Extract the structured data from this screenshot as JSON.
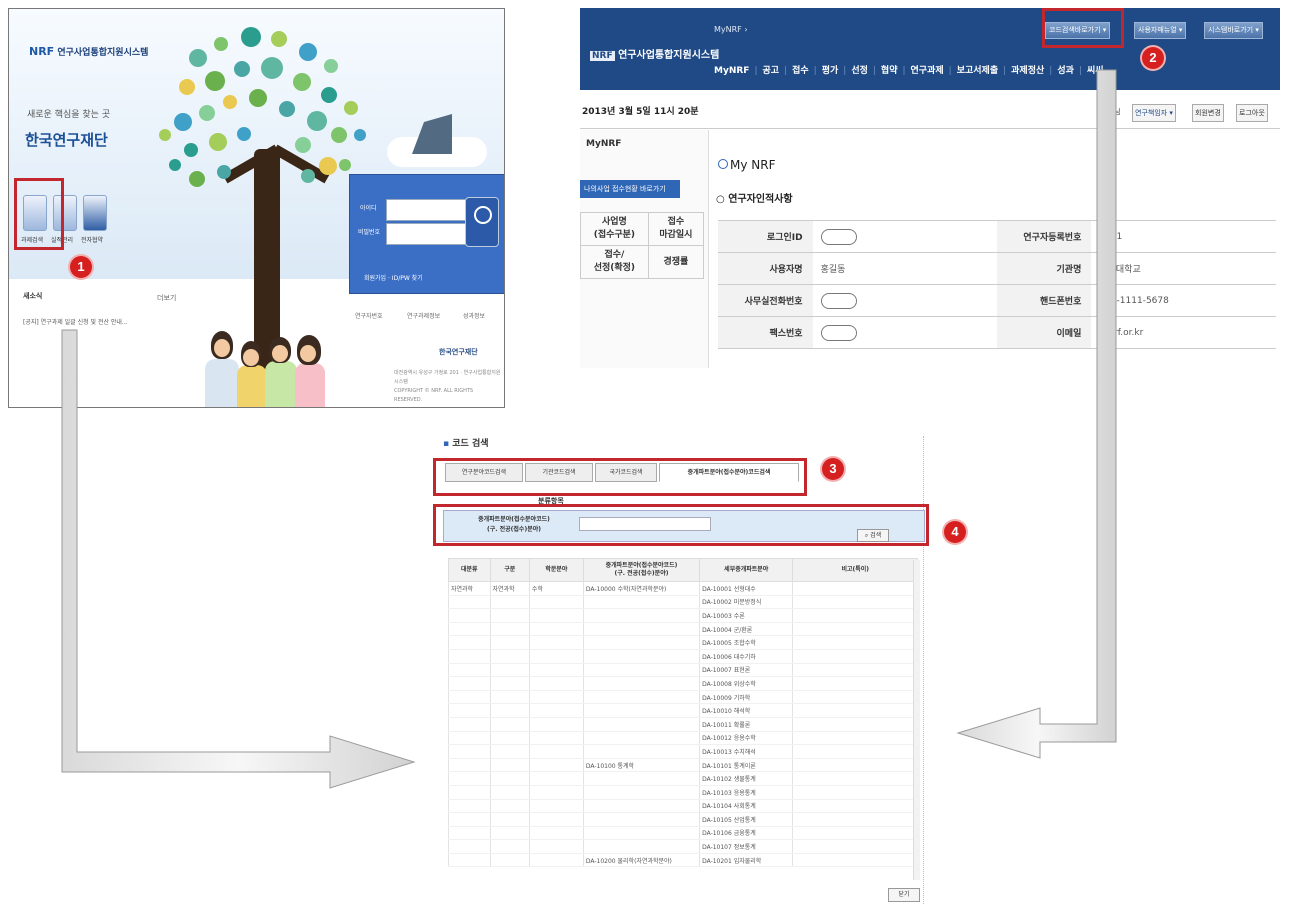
{
  "portal": {
    "logo_mark": "NRF",
    "logo_text": "연구사업통합지원시스템",
    "slogan": "새로운 핵심을 찾는 곳",
    "brand": "한국연구재단",
    "quick_icons": [
      "과제검색",
      "실적관리",
      "전자협약"
    ],
    "login": {
      "id_label": "아이디",
      "pw_label": "비밀번호",
      "link_text": "회원가입 · ID/PW 찾기"
    },
    "service_tabs": [
      "연구자번호",
      "연구과제정보",
      "성과정보"
    ],
    "notice_title": "새소식",
    "notice_more": "더보기",
    "notice_item": "[공지] 연구과제 일괄 신청 및 전산 안내...",
    "footer_logo": "한국연구재단",
    "footer_address": "대전광역시 유성구 가정로 201 · 연구사업통합지원시스템",
    "footer_copyright": "COPYRIGHT © NRF. ALL RIGHTS RESERVED."
  },
  "mynrf": {
    "logo_mark": "NRF",
    "logo_text": "연구사업통합지원시스템",
    "breadcrumb": "MyNRF",
    "top_buttons": [
      "코드검색바로가기",
      "사용자매뉴얼",
      "시스템바로가기"
    ],
    "menu": [
      "MyNRF",
      "공고",
      "접수",
      "평가",
      "선정",
      "협약",
      "연구과제",
      "보고서제출",
      "과제정산",
      "성과",
      "씨씨"
    ],
    "date": "2013년 3월 5일 11시 20분",
    "user_buttons": [
      "님",
      "연구책임자",
      "회원변경",
      "로그아웃"
    ],
    "side_title": "MyNRF",
    "side_highlight": "나의사업 접수현황 바로가기",
    "side_table": [
      [
        "사업명\n(접수구분)",
        "접수\n마감일시"
      ],
      [
        "접수/\n선정(확정)",
        "경쟁률"
      ]
    ],
    "page_title": "My NRF",
    "section_title": "연구자인적사항",
    "info_rows": [
      {
        "l1": "로그인ID",
        "v1": "",
        "l2": "연구자등록번호",
        "v2": "1111"
      },
      {
        "l1": "사용자명",
        "v1": "홍길동",
        "l2": "기관명",
        "v2": "한국대학교"
      },
      {
        "l1": "사무실전화번호",
        "v1": "",
        "l2": "핸드폰번호",
        "v2": "010-1111-5678"
      },
      {
        "l1": "팩스번호",
        "v1": "",
        "l2": "이메일",
        "v2": "@nrf.or.kr"
      }
    ]
  },
  "search": {
    "title": "코드 검색",
    "tabs": [
      "연구분야코드검색",
      "기관코드검색",
      "국가코드검색",
      "중개파트분야(접수분야)코드검색"
    ],
    "section_label": "분류항목",
    "field_label_line1": "중개파트분야(접수분야코드)",
    "field_label_line2": "(구. 전공(접수)분야)",
    "search_button": "검색",
    "columns": [
      "대분류",
      "구분",
      "학문분야",
      "중개파트분야(접수분야코드)\n(구. 전공(접수)분야)",
      "세부중개파트분야",
      "비고(특이)"
    ],
    "rows": [
      [
        "자연과학",
        "자연과학",
        "수학",
        "DA-10000 수학(자연과학분야)",
        "DA-10001 선형대수",
        ""
      ],
      [
        "",
        "",
        "",
        "",
        "DA-10002 미분방정식",
        ""
      ],
      [
        "",
        "",
        "",
        "",
        "DA-10003 수론",
        ""
      ],
      [
        "",
        "",
        "",
        "",
        "DA-10004 군/환론",
        ""
      ],
      [
        "",
        "",
        "",
        "",
        "DA-10005 조합수학",
        ""
      ],
      [
        "",
        "",
        "",
        "",
        "DA-10006 대수기하",
        ""
      ],
      [
        "",
        "",
        "",
        "",
        "DA-10007 표현론",
        ""
      ],
      [
        "",
        "",
        "",
        "",
        "DA-10008 위상수학",
        ""
      ],
      [
        "",
        "",
        "",
        "",
        "DA-10009 기하학",
        ""
      ],
      [
        "",
        "",
        "",
        "",
        "DA-10010 해석학",
        ""
      ],
      [
        "",
        "",
        "",
        "",
        "DA-10011 확률론",
        ""
      ],
      [
        "",
        "",
        "",
        "",
        "DA-10012 응용수학",
        ""
      ],
      [
        "",
        "",
        "",
        "",
        "DA-10013 수치해석",
        ""
      ],
      [
        "",
        "",
        "",
        "DA-10100 통계학",
        "DA-10101 통계이론",
        ""
      ],
      [
        "",
        "",
        "",
        "",
        "DA-10102 생물통계",
        ""
      ],
      [
        "",
        "",
        "",
        "",
        "DA-10103 응용통계",
        ""
      ],
      [
        "",
        "",
        "",
        "",
        "DA-10104 사회통계",
        ""
      ],
      [
        "",
        "",
        "",
        "",
        "DA-10105 산업통계",
        ""
      ],
      [
        "",
        "",
        "",
        "",
        "DA-10106 금융통계",
        ""
      ],
      [
        "",
        "",
        "",
        "",
        "DA-10107 정보통계",
        ""
      ],
      [
        "",
        "",
        "",
        "DA-10200 물리학(자연과학분야)",
        "DA-10201 입자물리학",
        ""
      ]
    ],
    "close_button": "닫기"
  },
  "markers": [
    "1",
    "2",
    "3",
    "4"
  ],
  "colors": {
    "annotation_red": "#c1272d",
    "marker_red": "#d6201f",
    "nav_blue": "#1f4a86",
    "login_blue": "#3b6fc6"
  }
}
